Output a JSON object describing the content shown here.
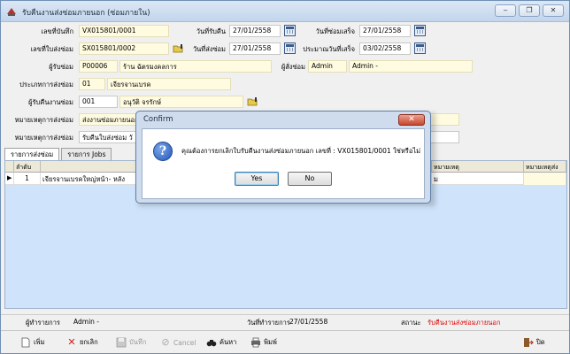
{
  "window": {
    "title": "รับคืนงานส่งซ่อมภายนอก (ซ่อมภายใน)",
    "controls": [
      "‒",
      "❐",
      "✕"
    ]
  },
  "form": {
    "doc_no": {
      "label": "เลขที่บันทึก",
      "value": "VX015801/0001"
    },
    "received_date": {
      "label": "วันที่รับคืน",
      "value": "27/01/2558"
    },
    "finish_date": {
      "label": "วันที่ซ่อมเสร็จ",
      "value": "27/01/2558"
    },
    "send_no": {
      "label": "เลขที่ใบส่งซ่อม",
      "value": "SX015801/0002"
    },
    "send_date": {
      "label": "วันที่ส่งซ่อม",
      "value": "27/01/2558"
    },
    "est_finish_date": {
      "label": "ประมาณวันที่เสร็จ",
      "value": "03/02/2558"
    },
    "repairer": {
      "label": "ผู้รับซ่อม",
      "code": "P00006",
      "name": "ร้าน ฉัตรมงคลการ"
    },
    "requester": {
      "label": "ผู้สั่งซ่อม",
      "code": "Admin",
      "name": "Admin -"
    },
    "repair_type": {
      "label": "ประเภทการส่งซ่อม",
      "code": "01",
      "name": "เจียรจานเบรค"
    },
    "receiver": {
      "label": "ผู้รับคืนงานซ่อม",
      "code": "001",
      "name": "อนุวัติ จรรักษ์"
    },
    "send_note": {
      "label": "หมายเหตุการส่งซ่อม",
      "value": "ส่งงานซ่อมภายนอก"
    },
    "receive_note": {
      "label": "หมายเหตุการส่งซ่อม",
      "value": "รับคืนใบส่งซ่อม วั"
    }
  },
  "tabs": [
    {
      "label": "รายการส่งซ่อม",
      "active": true
    },
    {
      "label": "รายการ Jobs",
      "active": false
    }
  ],
  "grid": {
    "columns": [
      "ลำดับ",
      "หมายเหตุ",
      "หมายเหตุส่ง"
    ],
    "rows": [
      {
        "seq": "1",
        "item": "เจียรจานเบรคใหญ่หน้า- หลัง",
        "note": "ม"
      }
    ]
  },
  "status": {
    "created_by_label": "ผู้ทำรายการ",
    "created_by": "Admin -",
    "created_date_label": "วันที่ทำรายการ",
    "created_date": "27/01/2558",
    "state_label": "สถานะ",
    "state_value": "รับคืนงานส่งซ่อมภายนอก",
    "state_color": "#e00000"
  },
  "toolbar": {
    "new": "เพิ่ม",
    "cancel_doc": "ยกเลิก",
    "save": "บันทึก",
    "cancel": "Cancel",
    "search": "ค้นหา",
    "print": "พิมพ์",
    "close": "ปิด"
  },
  "dialog": {
    "title": "Confirm",
    "close": "✕",
    "message": "คุณต้องการยกเลิกใบรับคืนงานส่งซ่อมภายนอก เลขที่ : VX015801/0001 ใช่หรือไม่",
    "yes": "Yes",
    "no": "No"
  }
}
